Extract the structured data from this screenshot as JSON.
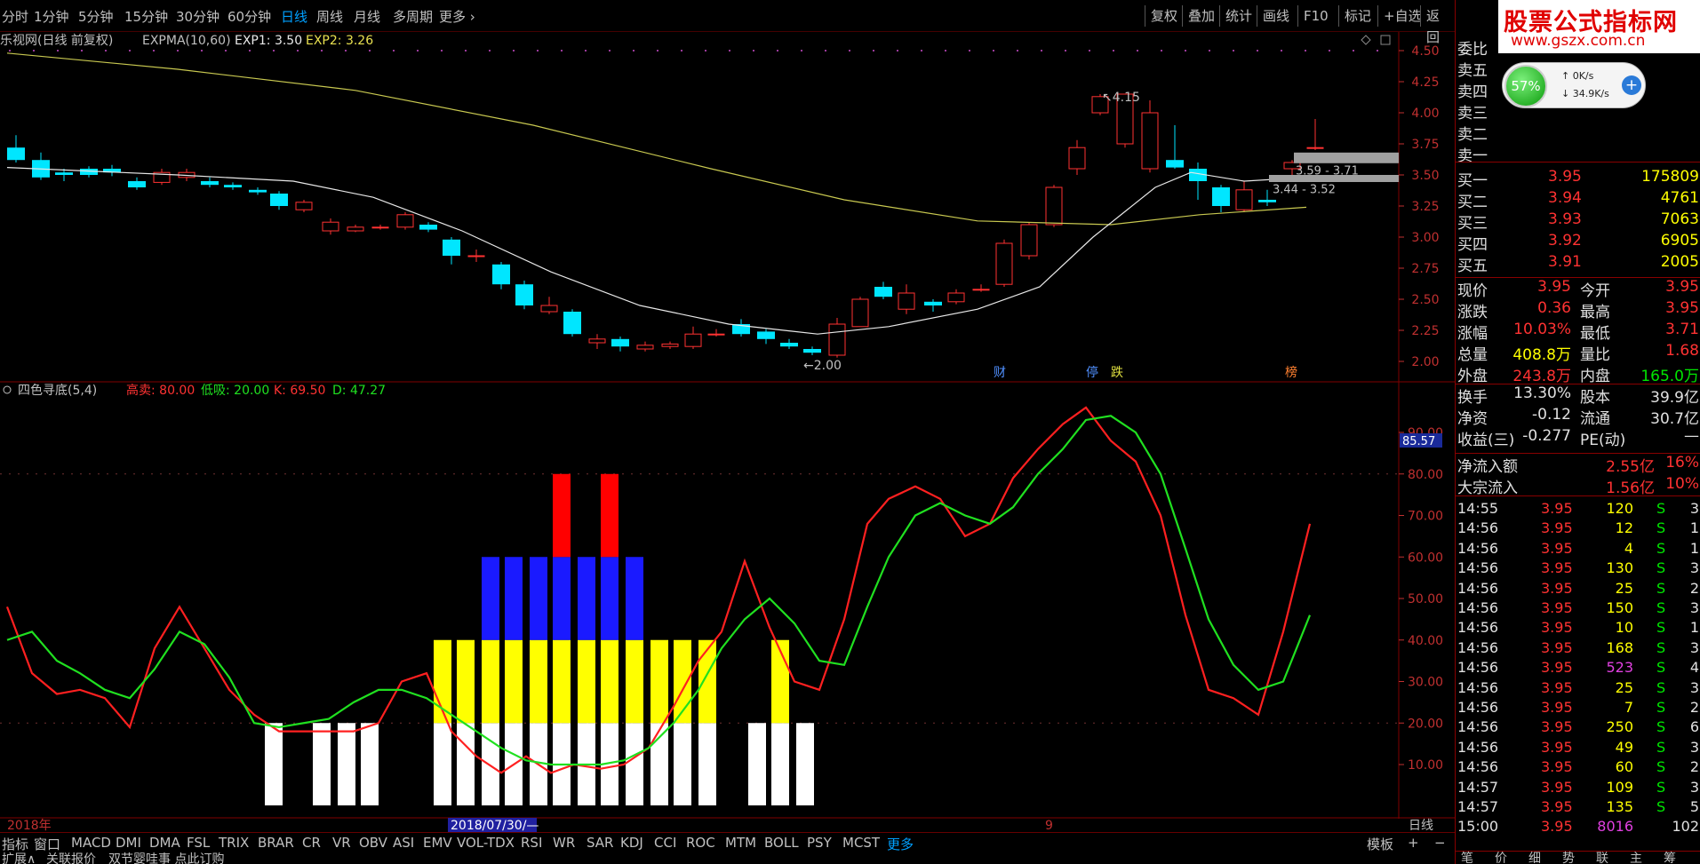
{
  "toolbar": {
    "periods": [
      "分时",
      "1分钟",
      "5分钟",
      "15分钟",
      "30分钟",
      "60分钟",
      "日线",
      "周线",
      "月线",
      "多周期",
      "更多"
    ],
    "active_period": "日线",
    "right_buttons": [
      "复权",
      "叠加",
      "统计",
      "画线",
      "F10",
      "标记",
      "+自选",
      "返回"
    ]
  },
  "main_chart": {
    "title": "乐视网(日线 前复权)",
    "indicator": "EXPMA(10,60)",
    "exp1_label": "EXP1: 3.50",
    "exp2_label": "EXP2: 3.26",
    "price_labels": [
      "4.50",
      "4.25",
      "4.00",
      "3.75",
      "3.50",
      "3.25",
      "3.00",
      "2.75",
      "2.50",
      "2.25",
      "2.00"
    ],
    "high_note": "4.15",
    "low_note": "2.00",
    "range1": "3.59 - 3.71",
    "range2": "3.44 - 3.52",
    "markers": [
      "财",
      "停",
      "跌",
      "榜"
    ],
    "colors": {
      "up": "#ff3232",
      "down": "#00e6ff",
      "exp1": "#e8e8e8",
      "exp2": "#c8c850"
    }
  },
  "sub_chart": {
    "title": "四色寻底(5,4)",
    "sell_label": "高卖: 80.00",
    "buy_label": "低吸: 20.00",
    "k_label": "K: 69.50",
    "d_label": "D: 47.27",
    "axis_labels": [
      "90.00",
      "80.00",
      "70.00",
      "60.00",
      "50.00",
      "40.00",
      "30.00",
      "20.00",
      "10.00"
    ],
    "current_value": "85.57",
    "colors": {
      "k": "#ff2020",
      "d": "#20e020",
      "white": "#ffffff",
      "yellow": "#ffff00",
      "blue": "#1a1aff",
      "red": "#ff0000"
    }
  },
  "time_axis": {
    "start_label": "2018年",
    "cursor_label": "2018/07/30/—",
    "mid_label": "9",
    "period_label": "日线"
  },
  "indicator_tabs": [
    "指标",
    "窗口",
    "MACD",
    "DMI",
    "DMA",
    "FSL",
    "TRIX",
    "BRAR",
    "CR",
    "VR",
    "OBV",
    "ASI",
    "EMV",
    "VOL-TDX",
    "RSI",
    "WR",
    "SAR",
    "KDJ",
    "CCI",
    "ROC",
    "MTM",
    "BOLL",
    "PSY",
    "MCST",
    "更多"
  ],
  "indicator_tabs_right": [
    "模板",
    "+",
    "−"
  ],
  "bottom_bar": [
    "扩展∧",
    "关联报价",
    "双节婴哇事 点此订购"
  ],
  "watermark": {
    "title": "股票公式指标网",
    "url": "www.gszx.com.cn"
  },
  "net_widget": {
    "percent": "57%",
    "up_speed": "0K/s",
    "down_speed": "34.9K/s"
  },
  "order_book": {
    "ratio_label": "委比",
    "sells": [
      {
        "label": "卖五",
        "price": "",
        "vol": ""
      },
      {
        "label": "卖四",
        "price": "",
        "vol": ""
      },
      {
        "label": "卖三",
        "price": "",
        "vol": ""
      },
      {
        "label": "卖二",
        "price": "",
        "vol": ""
      },
      {
        "label": "卖一",
        "price": "",
        "vol": ""
      }
    ],
    "buys": [
      {
        "label": "买一",
        "price": "3.95",
        "vol": "175809"
      },
      {
        "label": "买二",
        "price": "3.94",
        "vol": "4761"
      },
      {
        "label": "买三",
        "price": "3.93",
        "vol": "7063"
      },
      {
        "label": "买四",
        "price": "3.92",
        "vol": "6905"
      },
      {
        "label": "买五",
        "price": "3.91",
        "vol": "2005"
      }
    ]
  },
  "quote": [
    {
      "l1": "现价",
      "v1": "3.95",
      "c1": "red",
      "l2": "今开",
      "v2": "3.95",
      "c2": "red"
    },
    {
      "l1": "涨跌",
      "v1": "0.36",
      "c1": "red",
      "l2": "最高",
      "v2": "3.95",
      "c2": "red"
    },
    {
      "l1": "涨幅",
      "v1": "10.03%",
      "c1": "red",
      "l2": "最低",
      "v2": "3.71",
      "c2": "red"
    },
    {
      "l1": "总量",
      "v1": "408.8万",
      "c1": "yellow",
      "l2": "量比",
      "v2": "1.68",
      "c2": "red"
    },
    {
      "l1": "外盘",
      "v1": "243.8万",
      "c1": "red",
      "l2": "内盘",
      "v2": "165.0万",
      "c2": "green"
    }
  ],
  "quote2": [
    {
      "l1": "换手",
      "v1": "13.30%",
      "l2": "股本",
      "v2": "39.9亿"
    },
    {
      "l1": "净资",
      "v1": "-0.12",
      "l2": "流通",
      "v2": "30.7亿"
    },
    {
      "l1": "收益(三)",
      "v1": "-0.277",
      "l2": "PE(动)",
      "v2": "—"
    }
  ],
  "flows": [
    {
      "label": "净流入额",
      "value": "2.55亿",
      "pct": "16%"
    },
    {
      "label": "大宗流入",
      "value": "1.56亿",
      "pct": "10%"
    }
  ],
  "ticks": [
    {
      "time": "14:55",
      "price": "3.95",
      "vol": "120",
      "side": "S",
      "n": "3",
      "vc": "yellow"
    },
    {
      "time": "14:56",
      "price": "3.95",
      "vol": "12",
      "side": "S",
      "n": "1",
      "vc": "yellow"
    },
    {
      "time": "14:56",
      "price": "3.95",
      "vol": "4",
      "side": "S",
      "n": "1",
      "vc": "yellow"
    },
    {
      "time": "14:56",
      "price": "3.95",
      "vol": "130",
      "side": "S",
      "n": "3",
      "vc": "yellow"
    },
    {
      "time": "14:56",
      "price": "3.95",
      "vol": "25",
      "side": "S",
      "n": "2",
      "vc": "yellow"
    },
    {
      "time": "14:56",
      "price": "3.95",
      "vol": "150",
      "side": "S",
      "n": "3",
      "vc": "yellow"
    },
    {
      "time": "14:56",
      "price": "3.95",
      "vol": "10",
      "side": "S",
      "n": "1",
      "vc": "yellow"
    },
    {
      "time": "14:56",
      "price": "3.95",
      "vol": "168",
      "side": "S",
      "n": "3",
      "vc": "yellow"
    },
    {
      "time": "14:56",
      "price": "3.95",
      "vol": "523",
      "side": "S",
      "n": "4",
      "vc": "magenta"
    },
    {
      "time": "14:56",
      "price": "3.95",
      "vol": "25",
      "side": "S",
      "n": "3",
      "vc": "yellow"
    },
    {
      "time": "14:56",
      "price": "3.95",
      "vol": "7",
      "side": "S",
      "n": "2",
      "vc": "yellow"
    },
    {
      "time": "14:56",
      "price": "3.95",
      "vol": "250",
      "side": "S",
      "n": "6",
      "vc": "yellow"
    },
    {
      "time": "14:56",
      "price": "3.95",
      "vol": "49",
      "side": "S",
      "n": "3",
      "vc": "yellow"
    },
    {
      "time": "14:56",
      "price": "3.95",
      "vol": "60",
      "side": "S",
      "n": "2",
      "vc": "yellow"
    },
    {
      "time": "14:57",
      "price": "3.95",
      "vol": "109",
      "side": "S",
      "n": "3",
      "vc": "yellow"
    },
    {
      "time": "14:57",
      "price": "3.95",
      "vol": "135",
      "side": "S",
      "n": "5",
      "vc": "yellow"
    },
    {
      "time": "15:00",
      "price": "3.95",
      "vol": "8016",
      "side": "",
      "n": "102",
      "vc": "magenta"
    }
  ],
  "panel_tabs": [
    "笔",
    "价",
    "细",
    "势",
    "联",
    "主",
    "筹"
  ]
}
